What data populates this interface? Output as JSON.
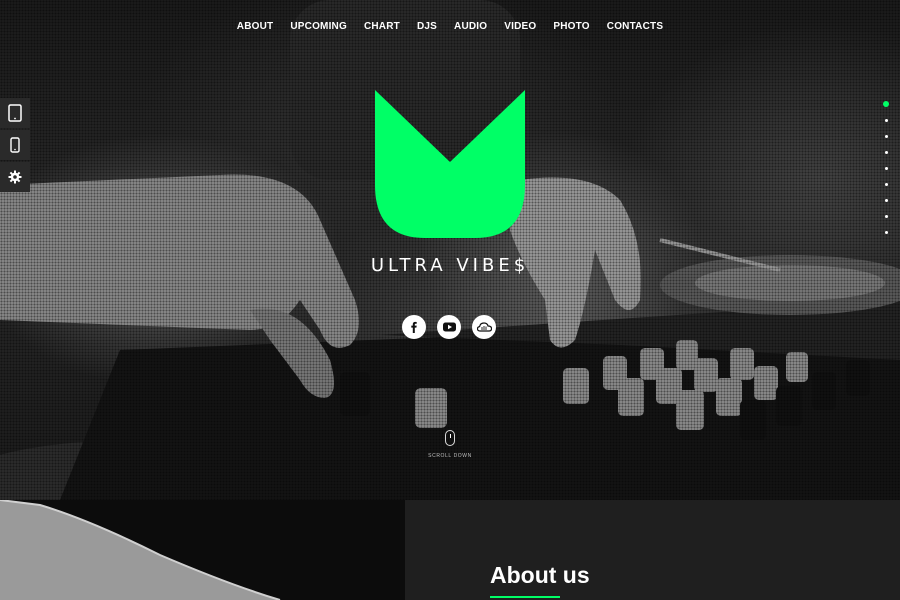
{
  "nav": {
    "items": [
      {
        "label": "ABOUT"
      },
      {
        "label": "UPCOMING"
      },
      {
        "label": "CHART"
      },
      {
        "label": "DJS"
      },
      {
        "label": "AUDIO"
      },
      {
        "label": "VIDEO"
      },
      {
        "label": "PHOTO"
      },
      {
        "label": "CONTACTS"
      }
    ]
  },
  "brand": {
    "name": "ULTRA VIBE$",
    "logo_icon": "v-shield-logo",
    "accent_color": "#00ff66"
  },
  "social": [
    {
      "icon": "facebook-icon"
    },
    {
      "icon": "youtube-icon"
    },
    {
      "icon": "soundcloud-icon"
    }
  ],
  "scroll": {
    "label": "SCROLL DOWN",
    "icon": "mouse-icon"
  },
  "tools": [
    {
      "icon": "tablet-icon"
    },
    {
      "icon": "phone-icon"
    },
    {
      "icon": "gear-icon"
    }
  ],
  "dots": {
    "count": 9,
    "active_index": 0
  },
  "about": {
    "title": "About us"
  }
}
